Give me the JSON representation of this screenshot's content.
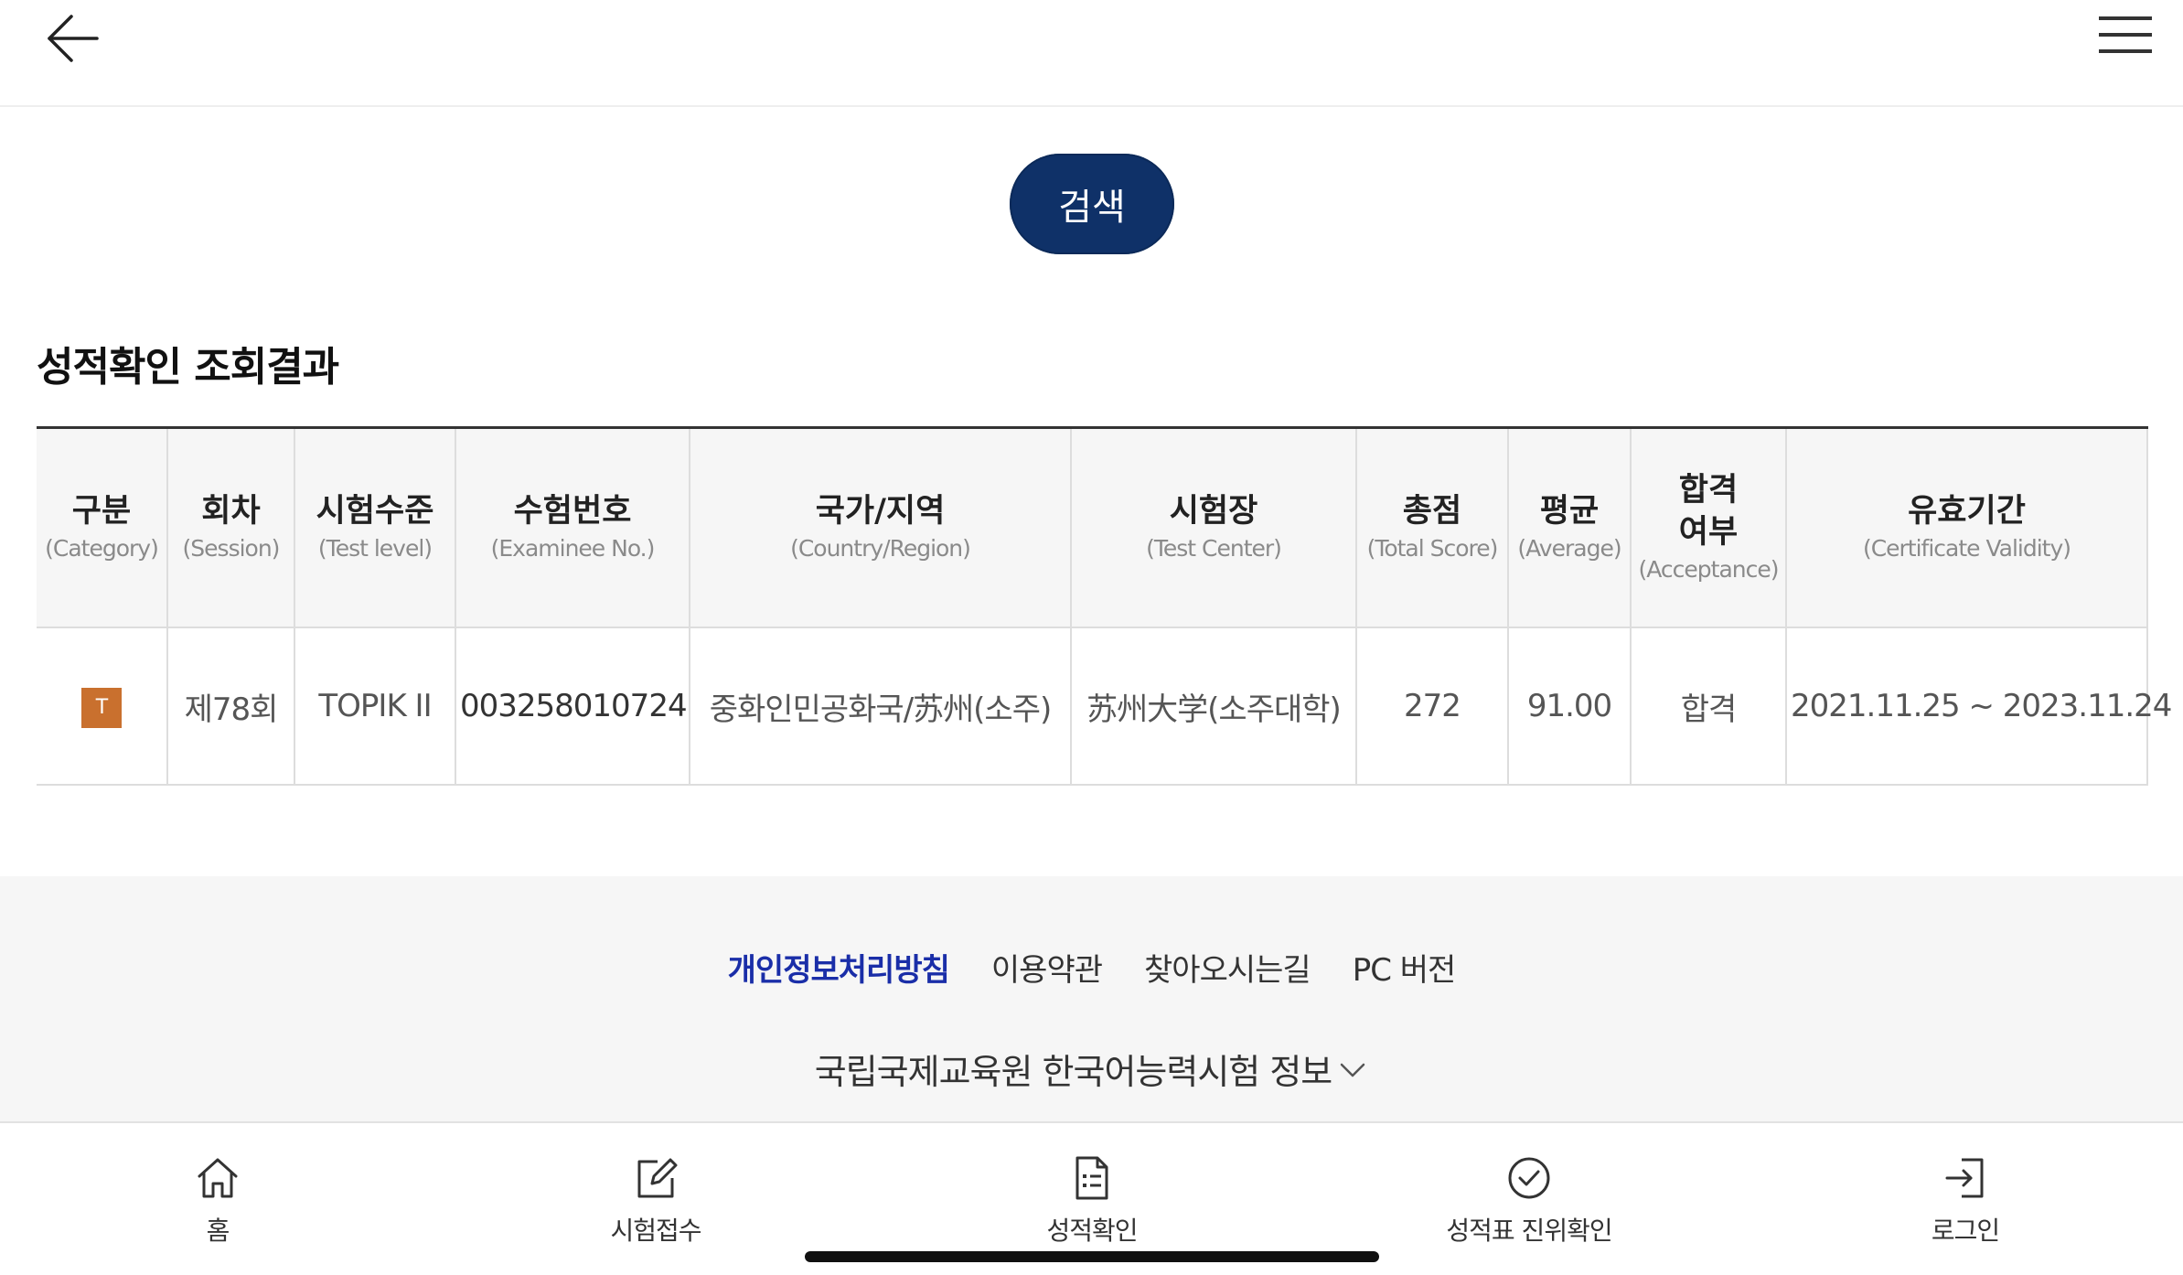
{
  "header": {
    "back_icon": "arrow-left-icon",
    "menu_icon": "hamburger-menu-icon"
  },
  "search": {
    "label": "검색",
    "color": "#0f3168"
  },
  "result": {
    "title": "성적확인 조회결과",
    "columns": [
      {
        "ko": "구분",
        "en": "(Category)"
      },
      {
        "ko": "회차",
        "en": "(Session)"
      },
      {
        "ko": "시험수준",
        "en": "(Test level)"
      },
      {
        "ko": "수험번호",
        "en": "(Examinee No.)"
      },
      {
        "ko": "국가/지역",
        "en": "(Country/Region)"
      },
      {
        "ko": "시험장",
        "en": "(Test Center)"
      },
      {
        "ko": "총점",
        "en": "(Total Score)"
      },
      {
        "ko": "평균",
        "en": "(Average)"
      },
      {
        "ko": "합격 여부",
        "en": "(Acceptance)"
      },
      {
        "ko": "유효기간",
        "en": "(Certificate Validity)"
      }
    ],
    "rows": [
      {
        "category": "T",
        "session": "제78회",
        "level": "TOPIK II",
        "examinee_no": "003258010724",
        "region": "중화인민공화국/苏州(소주)",
        "center": "苏州大学(소주대학)",
        "total": "272",
        "average": "91.00",
        "acceptance": "합격",
        "validity": "2021.11.25 ~ 2023.11.24"
      }
    ],
    "badge_color": "#c9702e"
  },
  "footer": {
    "links": [
      "개인정보처리방침",
      "이용약관",
      "찾아오시는길",
      "PC 버전"
    ],
    "info": "국립국제교육원 한국어능력시험 정보",
    "info_icon": "chevron-down-icon",
    "privacy_color": "#1a2ea8"
  },
  "nav": [
    {
      "label": "홈",
      "icon": "home-icon"
    },
    {
      "label": "시험접수",
      "icon": "edit-icon"
    },
    {
      "label": "성적확인",
      "icon": "document-list-icon"
    },
    {
      "label": "성적표 진위확인",
      "icon": "check-circle-icon"
    },
    {
      "label": "로그인",
      "icon": "login-icon"
    }
  ]
}
